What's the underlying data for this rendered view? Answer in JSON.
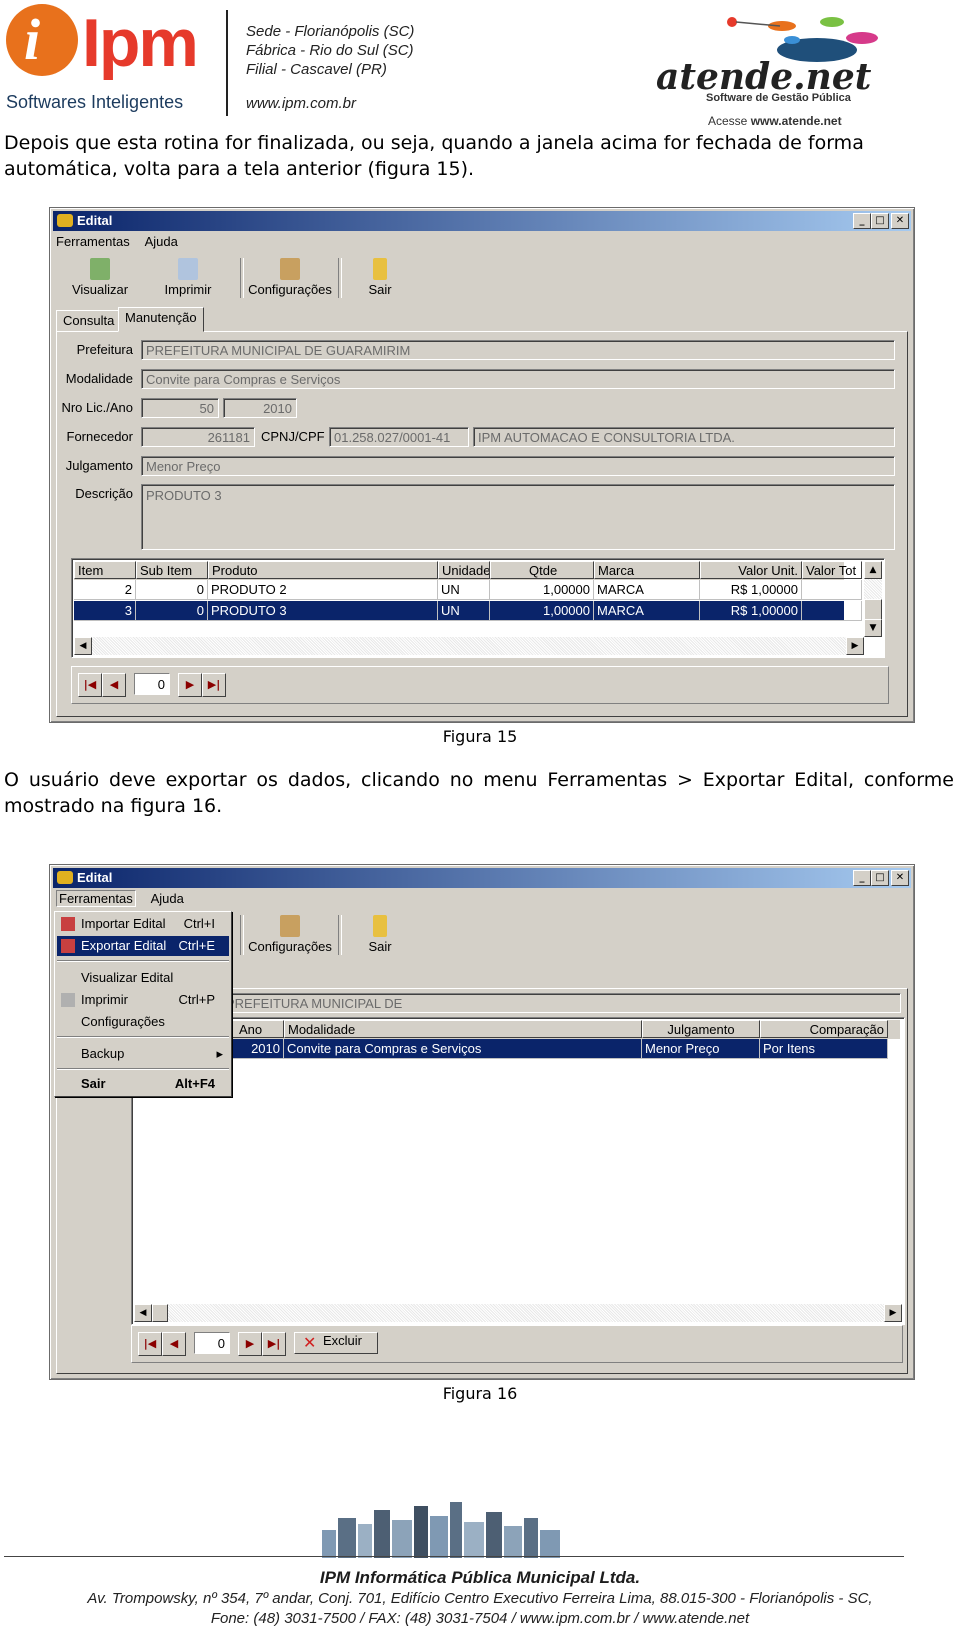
{
  "header": {
    "logo_letter": "i",
    "logo_name": "Ipm",
    "logo_tagline": "Softwares Inteligentes",
    "locations": [
      "Sede - Florianópolis (SC)",
      "Fábrica - Rio do Sul (SC)",
      "Filial - Cascavel (PR)"
    ],
    "website": "www.ipm.com.br",
    "atende_name": "atende.net",
    "atende_tagline": "Software de Gestão Pública",
    "atende_access_prefix": "Acesse",
    "atende_access_url": "www.atende.net"
  },
  "paragraph1": "Depois que esta rotina for finalizada, ou seja, quando a janela acima for fechada de forma automática, volta para a tela anterior (figura 15).",
  "window1": {
    "title": "Edital",
    "menu": [
      "Ferramentas",
      "Ajuda"
    ],
    "toolbar": [
      "Visualizar",
      "Imprimir",
      "Configurações",
      "Sair"
    ],
    "tabs": [
      "Consulta",
      "Manutenção"
    ],
    "labels": {
      "prefeitura": "Prefeitura",
      "modalidade": "Modalidade",
      "nro": "Nro Lic./Ano",
      "fornecedor": "Fornecedor",
      "cnpj": "CPNJ/CPF",
      "julgamento": "Julgamento",
      "descricao": "Descrição"
    },
    "values": {
      "prefeitura": "PREFEITURA MUNICIPAL DE GUARAMIRIM",
      "modalidade": "Convite para Compras e Serviços",
      "nro": "50",
      "ano": "2010",
      "fornecedor_code": "261181",
      "cnpj": "01.258.027/0001-41",
      "fornecedor_name": "IPM AUTOMACAO E CONSULTORIA LTDA.",
      "julgamento": "Menor Preço",
      "descricao": "PRODUTO 3"
    },
    "grid": {
      "columns": [
        "Item",
        "Sub Item",
        "Produto",
        "Unidade",
        "Qtde",
        "Marca",
        "Valor Unit.",
        "Valor Tot"
      ],
      "rows": [
        [
          "2",
          "0",
          "PRODUTO 2",
          "UN",
          "1,00000",
          "MARCA",
          "R$ 1,00000"
        ],
        [
          "3",
          "0",
          "PRODUTO 3",
          "UN",
          "1,00000",
          "MARCA",
          "R$ 1,00000"
        ]
      ]
    },
    "nav_value": "0"
  },
  "caption1": "Figura 15",
  "paragraph2": "O usuário deve exportar os dados, clicando no menu Ferramentas > Exportar Edital, conforme mostrado na figura 16.",
  "window2": {
    "title": "Edital",
    "menu": [
      "Ferramentas",
      "Ajuda"
    ],
    "toolbar": [
      "Configurações",
      "Sair"
    ],
    "dropdown": [
      {
        "label": "Importar Edital",
        "shortcut": "Ctrl+I"
      },
      {
        "label": "Exportar Edital",
        "shortcut": "Ctrl+E"
      },
      {
        "label": "Visualizar Edital",
        "shortcut": ""
      },
      {
        "label": "Imprimir",
        "shortcut": "Ctrl+P"
      },
      {
        "label": "Configurações",
        "shortcut": ""
      },
      {
        "label": "Backup",
        "shortcut": ""
      },
      {
        "label": "Sair",
        "shortcut": "Alt+F4"
      }
    ],
    "prefeitura_partial": "PREFEITURA MUNICIPAL DE",
    "grid": {
      "columns": [
        "Ano",
        "Modalidade",
        "Julgamento",
        "Comparação"
      ],
      "rows": [
        [
          "2010",
          "Convite para Compras e Serviços",
          "Menor Preço",
          "Por Itens"
        ]
      ]
    },
    "nav_value": "0",
    "excluir": "Excluir"
  },
  "caption2": "Figura 16",
  "footer": {
    "company": "IPM Informática Pública Municipal Ltda.",
    "address": "Av. Trompowsky, nº 354, 7º andar, Conj. 701, Edifício Centro Executivo Ferreira Lima, 88.015-300 - Florianópolis - SC,",
    "phone": "Fone: (48) 3031-7500 / FAX: (48) 3031-7504 / www.ipm.com.br / www.atende.net"
  },
  "colors": {
    "brand_orange": "#e8711c",
    "brand_red": "#e63a2b",
    "selection": "#0a246a",
    "window_face": "#d4d0c8"
  }
}
